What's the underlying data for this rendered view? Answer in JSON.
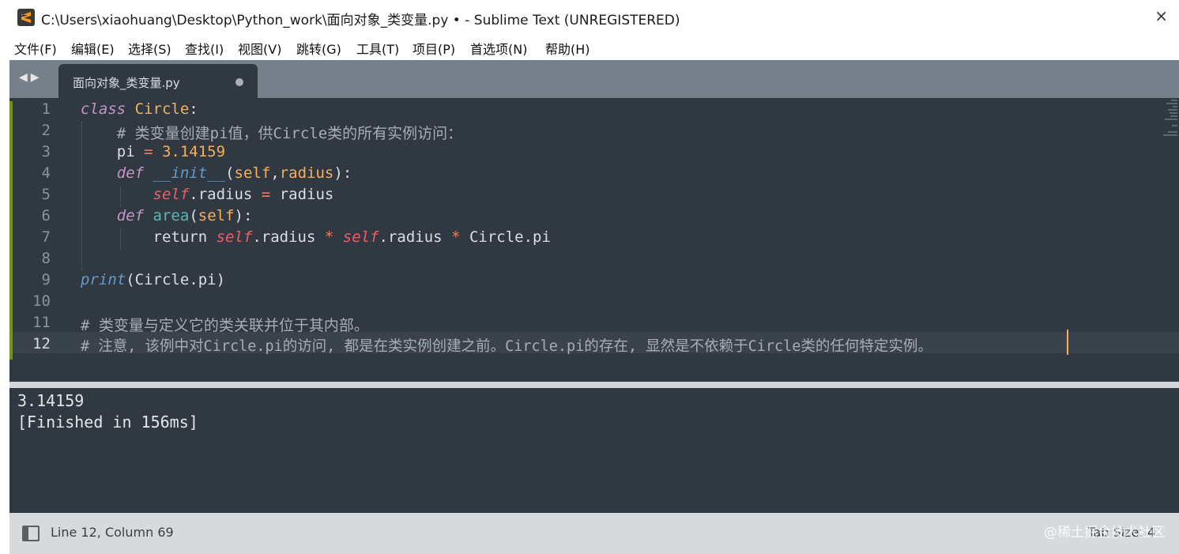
{
  "window": {
    "title": "C:\\Users\\xiaohuang\\Desktop\\Python_work\\面向对象_类变量.py • - Sublime Text (UNREGISTERED)",
    "close_glyph": "×"
  },
  "menu": {
    "items": [
      "文件(F)",
      "编辑(E)",
      "选择(S)",
      "查找(I)",
      "视图(V)",
      "跳转(G)",
      "工具(T)",
      "项目(P)",
      "首选项(N)",
      "帮助(H)"
    ]
  },
  "tabs": {
    "nav_glyph": "◀▶",
    "active_tab": "面向对象_类变量.py"
  },
  "editor": {
    "line_numbers": [
      "1",
      "2",
      "3",
      "4",
      "5",
      "6",
      "7",
      "8",
      "9",
      "10",
      "11",
      "12"
    ],
    "current_line": 12,
    "lines": {
      "l1": {
        "a": "class",
        "b": " ",
        "c": "Circle",
        "d": ":"
      },
      "l2": "    # 类变量创建pi值，供Circle类的所有实例访问：",
      "l3": {
        "a": "    pi ",
        "b": "=",
        "c": " ",
        "d": "3.14159"
      },
      "l4": {
        "a": "    ",
        "b": "def",
        "c": " ",
        "d": "__init__",
        "e": "(",
        "f": "self",
        "g": ",",
        "h": "radius",
        "i": "):"
      },
      "l5": {
        "a": "        ",
        "b": "self",
        "c": ".radius ",
        "d": "=",
        "e": " radius"
      },
      "l6": {
        "a": "    ",
        "b": "def",
        "c": " ",
        "d": "area",
        "e": "(",
        "f": "self",
        "g": "):"
      },
      "l7": {
        "a": "        return ",
        "b": "self",
        "c": ".radius ",
        "d": "*",
        "e": " ",
        "f": "self",
        "g": ".radius ",
        "h": "*",
        "i": " Circle.pi"
      },
      "l9": {
        "a": "print",
        "b": "(Circle.pi)"
      },
      "l11": "# 类变量与定义它的类关联并位于其内部。",
      "l12": "# 注意, 该例中对Circle.pi的访问, 都是在类实例创建之前。Circle.pi的存在, 显然是不依赖于Circle类的任何特定实例。"
    }
  },
  "output": {
    "lines": [
      "3.14159",
      "[Finished in 156ms]"
    ]
  },
  "status": {
    "position": "Line 12, Column 69",
    "tab_size": "Tab Size: 4",
    "watermark": "@稀土掘金技术社区"
  },
  "colors": {
    "editor_bg": "#303841",
    "keyword": "#c594c5",
    "class_name": "#f9ae58",
    "comment": "#a6acb9",
    "self": "#ec5f66",
    "function": "#6699cc"
  }
}
